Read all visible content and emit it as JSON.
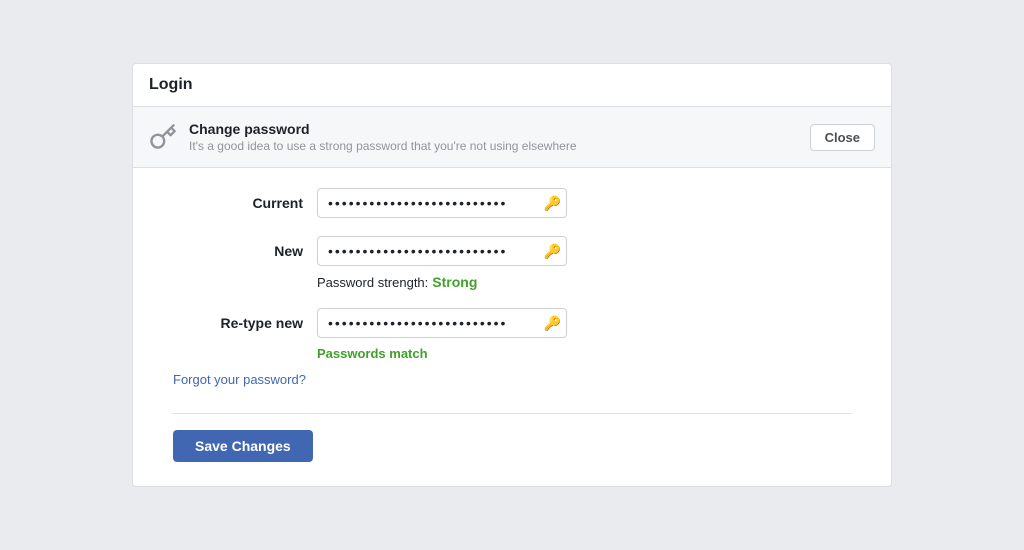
{
  "header": {
    "title": "Login"
  },
  "section": {
    "title": "Change password",
    "subtitle": "It's a good idea to use a strong password that you're not using elsewhere",
    "close_label": "Close"
  },
  "form": {
    "current_label": "Current",
    "new_label": "New",
    "retype_label": "Re-type new",
    "current_value": "••••••••••••••••••••••••••",
    "new_value": "••••••••••••••••••••••••••",
    "retype_value": "••••••••••••••••••••••••••",
    "strength_label": "Password strength:",
    "strength_value": "Strong",
    "match_text": "Passwords match",
    "forgot_link": "Forgot your password?",
    "save_label": "Save Changes"
  },
  "icons": {
    "key": "🔑",
    "password_manager": "🔑"
  }
}
